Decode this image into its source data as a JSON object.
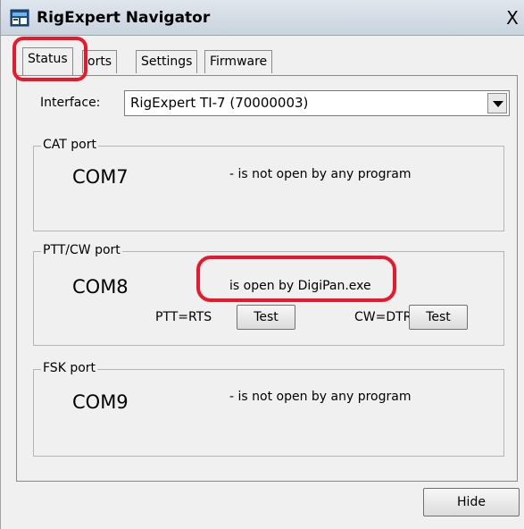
{
  "window": {
    "title": "RigExpert Navigator",
    "close_glyph": "X"
  },
  "tabs": [
    {
      "label": "Status",
      "active": true
    },
    {
      "label": "Ports",
      "visible_text": "orts",
      "active": false
    },
    {
      "label": "Settings",
      "active": false
    },
    {
      "label": "Firmware",
      "active": false
    }
  ],
  "interface": {
    "label": "Interface:",
    "value": "RigExpert TI-7 (70000003)"
  },
  "cat": {
    "title": "CAT port",
    "port": "COM7",
    "status": "- is not open by any program"
  },
  "ptt": {
    "title": "PTT/CW port",
    "port": "COM8",
    "status": "is open by DigiPan.exe",
    "ptt_label": "PTT=RTS",
    "ptt_test": "Test",
    "cw_label": "CW=DTR",
    "cw_test": "Test"
  },
  "fsk": {
    "title": "FSK port",
    "port": "COM9",
    "status": "- is not open by any program"
  },
  "footer": {
    "hide_label": "Hide"
  },
  "colors": {
    "highlight": "#e8192c",
    "titlebar": "#cfd8e2"
  },
  "icons": {
    "app": "rigexpert-app-icon",
    "dropdown": "chevron-down-icon"
  }
}
